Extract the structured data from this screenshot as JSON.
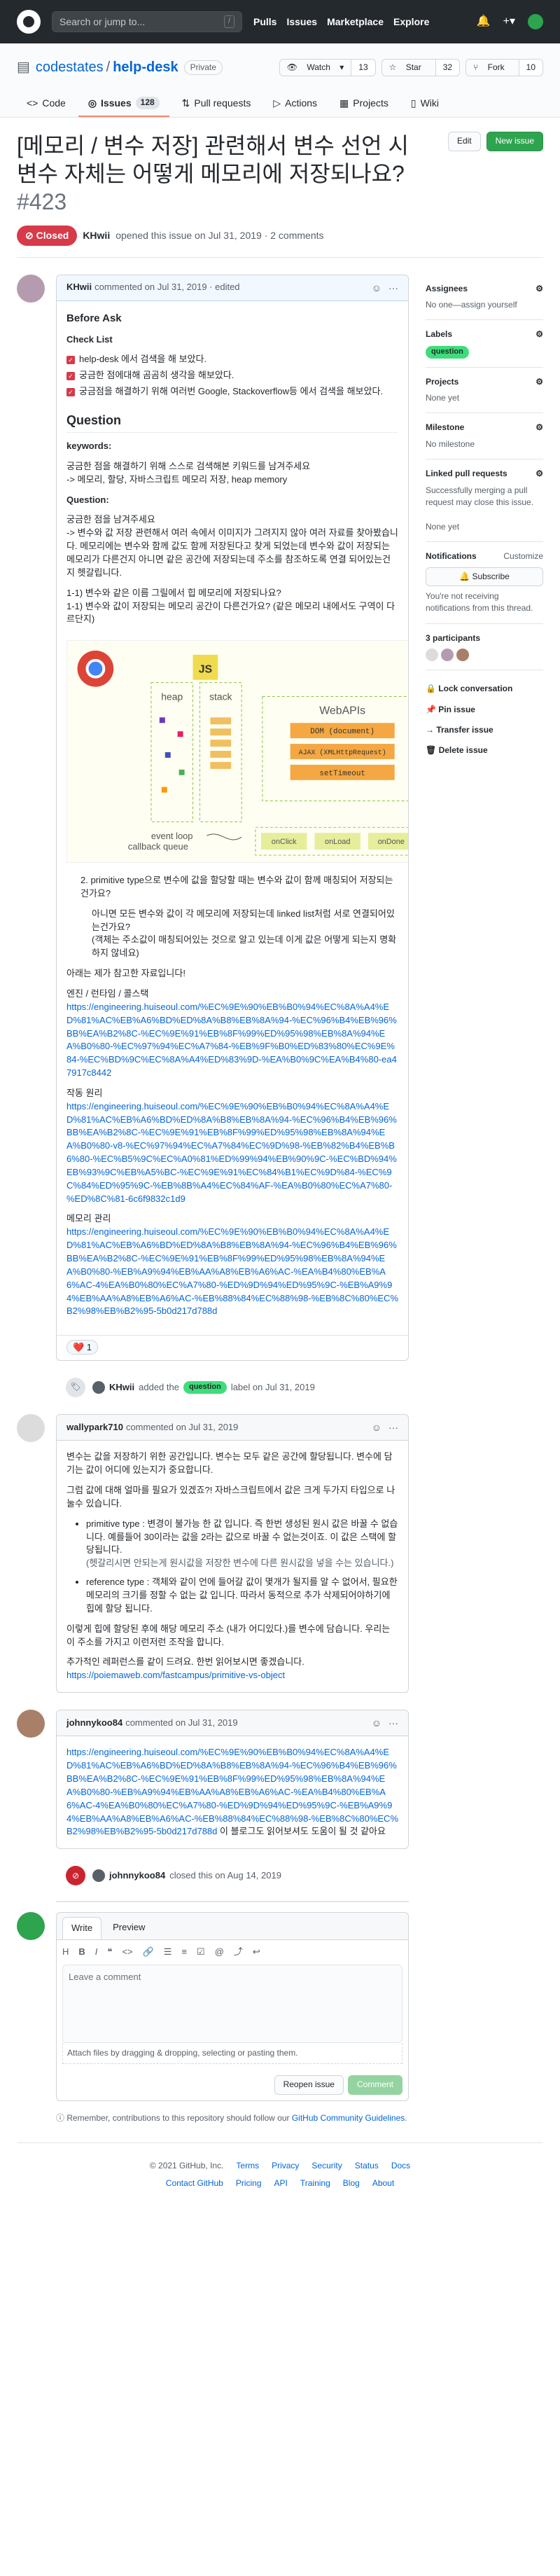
{
  "header": {
    "search_placeholder": "Search or jump to...",
    "search_key": "/",
    "nav": [
      "Pulls",
      "Issues",
      "Marketplace",
      "Explore"
    ]
  },
  "repo": {
    "owner": "codestates",
    "name": "help-desk",
    "visibility": "Private",
    "watch_label": "Watch",
    "watch_count": "13",
    "star_label": "Star",
    "star_count": "32",
    "fork_label": "Fork",
    "fork_count": "10",
    "tabs": [
      {
        "label": "Code"
      },
      {
        "label": "Issues",
        "count": "128"
      },
      {
        "label": "Pull requests"
      },
      {
        "label": "Actions"
      },
      {
        "label": "Projects"
      },
      {
        "label": "Wiki"
      }
    ]
  },
  "issue": {
    "title": "[메모리 / 변수 저장] 관련해서 변수 선언 시 변수 자체는 어떻게 메모리에 저장되나요?",
    "number": "#423",
    "edit_label": "Edit",
    "new_issue_label": "New issue",
    "state": "Closed",
    "author": "KHwii",
    "opened_text": "opened this issue on Jul 31, 2019 · 2 comments"
  },
  "comments": [
    {
      "author": "KHwii",
      "meta": "commented on Jul 31, 2019 · edited",
      "before_ask_title": "Before Ask",
      "checklist_title": "Check List",
      "checklist": [
        "help-desk 에서 검색을 해 보았다.",
        "궁금한 점에대해 곰곰히 생각을 해보았다.",
        "궁금점을 해결하기 위해 여러번 Google, Stackoverflow등 에서 검색을 해보았다."
      ],
      "question_title": "Question",
      "keywords_label": "keywords:",
      "keywords_text": "궁금한 점을 해결하기 위해 스스로 검색해본 키워드를 남겨주세요",
      "keywords_value": "-> 메모리, 할당, 자바스크립트 메모리 저장, heap memory",
      "question_label": "Question:",
      "question_intro": "궁금한 점을 남겨주세요",
      "question_body": "-> 변수와 값 저장 관련해서 여러 속에서 이미지가 그려지지 않아 여러 자료를 찾아봤습니다. 메모리에는 변수와 함께 값도 함께 저장된다고 찾게 되었는데 변수와 값이 저장되는 메모리가 다른건지 아니면 같은 공간에 저장되는데 주소를 참조하도록 연결 되어있는건지 헷갈립니다.",
      "question_items": [
        "1-1) 변수와 같은 이름 그릴에서 힙 메모리에 저장되나요?",
        "1-1) 변수와 값이 저장되는 메모리 공간이 다른건가요? (같은 메모리 내에서도 구역이 다르단지)"
      ],
      "diagram": {
        "heap": "heap",
        "stack": "stack",
        "webapis": "WebAPIs",
        "api1": "DOM (document)",
        "api2": "AJAX (XMLHttpRequest)",
        "api3": "setTimeout",
        "event_loop": "event loop",
        "callback_queue": "callback queue",
        "queue_items": [
          "onClick",
          "onLoad",
          "onDone"
        ],
        "js": "JS"
      },
      "item2_title": "2. primitive type으로 변수에 값을 할당할 때는 변수와 값이 함께 매칭되어 저장되는 건가요?",
      "item2_sub1": "아니면 모든 변수와 값이 각 메모리에 저장되는데 linked list처럼 서로 연결되어있는건가요?",
      "item2_sub2": "(객체는 주소값이 매칭되어있는 것으로 알고 있는데 이게 값은 어떻게 되는지 명확하지 않네요)",
      "refs_intro": "아래는 제가 참고한 자료입니다!",
      "refs": [
        {
          "title": "엔진 / 런타임 / 콜스택",
          "url": "https://engineering.huiseoul.com/%EC%9E%90%EB%B0%94%EC%8A%A4%ED%81%AC%EB%A6%BD%ED%8A%B8%EB%8A%94-%EC%96%B4%EB%96%BB%EA%B2%8C-%EC%9E%91%EB%8F%99%ED%95%98%EB%8A%94%EA%B0%80-%EC%97%94%EC%A7%84-%EB%9F%B0%ED%83%80%EC%9E%84-%EC%BD%9C%EC%8A%A4%ED%83%9D-%EA%B0%9C%EA%B4%80-ea47917c8442"
        },
        {
          "title": "작동 원리",
          "url": "https://engineering.huiseoul.com/%EC%9E%90%EB%B0%94%EC%8A%A4%ED%81%AC%EB%A6%BD%ED%8A%B8%EB%8A%94-%EC%96%B4%EB%96%BB%EA%B2%8C-%EC%9E%91%EB%8F%99%ED%95%98%EB%8A%94%EA%B0%80-v8-%EC%97%94%EC%A7%84%EC%9D%98-%EB%82%B4%EB%B6%80-%EC%B5%9C%EC%A0%81%ED%99%94%EB%90%9C-%EC%BD%94%EB%93%9C%EB%A5%BC-%EC%9E%91%EC%84%B1%EC%9D%84-%EC%9C%84%ED%95%9C-%EB%8B%A4%EC%84%AF-%EA%B0%80%EC%A7%80-%ED%8C%81-6c6f9832c1d9"
        },
        {
          "title": "메모리 관리",
          "url": "https://engineering.huiseoul.com/%EC%9E%90%EB%B0%94%EC%8A%A4%ED%81%AC%EB%A6%BD%ED%8A%B8%EB%8A%94-%EC%96%B4%EB%96%BB%EA%B2%8C-%EC%9E%91%EB%8F%99%ED%95%98%EB%8A%94%EA%B0%80-%EB%A9%94%EB%AA%A8%EB%A6%AC-%EA%B4%80%EB%A6%AC-4%EA%B0%80%EC%A7%80-%ED%9D%94%ED%95%9C-%EB%A9%94%EB%AA%A8%EB%A6%AC-%EB%88%84%EC%88%98-%EB%8C%80%EC%B2%98%EB%B2%95-5b0d217d788d"
        }
      ],
      "reaction": "❤️ 1"
    },
    {
      "author": "wallypark710",
      "meta": "commented on Jul 31, 2019",
      "p1": "변수는 값을 저장하기 위한 공간입니다. 변수는 모두 같은 공간에 할당됩니다. 변수에 담기는 값이 어디에 있는지가 중요합니다.",
      "p2": "그럼 값에 대해 얼마를 필요가 있겠죠?! 자바스크립트에서 값은 크게 두가지 타입으로 나눌수 있습니다.",
      "bullets": [
        {
          "head": "primitive type",
          "text": ": 변경이 불가능 한 값 입니다. 즉 한번 생성된 원시 값은 바꿀 수 없습니다. 예를들어 30이라는 값을 2라는 값으로 바꿀 수 없는것이죠. 이 값은 스택에 할당됩니다.",
          "note": "(헷갈리시면 안되는게 원시값을 저장한 변수에 다른 원시값을 넣을 수는 있습니다.)"
        },
        {
          "head": "reference type",
          "text": ": 객체와 같이 언에 들어갈 값이 몇개가 될지를 알 수 없어서, 필요한 메모리의 크기를 정할 수 없는 값 입니다. 따라서 동적으로 추가 삭제되어야하기에 힙에 할당 됩니다.",
          "note": ""
        }
      ],
      "p3": "이렇게 힙에 할당된 후에 해당 메모리 주소 (내가 어디있다.)를 변수에 담습니다. 우리는 이 주소를 가지고 이런저런 조작을 합니다.",
      "p4": "추가적인 레퍼런스를 같이 드려요. 한번 읽어보시면 좋겠습니다.",
      "link": "https://poiemaweb.com/fastcampus/primitive-vs-object"
    },
    {
      "author": "johnnykoo84",
      "meta": "commented on Jul 31, 2019",
      "link": "https://engineering.huiseoul.com/%EC%9E%90%EB%B0%94%EC%8A%A4%ED%81%AC%EB%A6%BD%ED%8A%B8%EB%8A%94-%EC%96%B4%EB%96%BB%EA%B2%8C-%EC%9E%91%EB%8F%99%ED%95%98%EB%8A%94%EA%B0%80-%EB%A9%94%EB%AA%A8%EB%A6%AC-%EA%B4%80%EB%A6%AC-4%EA%B0%80%EC%A7%80-%ED%9D%94%ED%95%9C-%EB%A9%94%EB%AA%A8%EB%A6%AC-%EB%88%84%EC%88%98-%EB%8C%80%EC%B2%98%EB%B2%95-5b0d217d788d",
      "suffix": " 이 블로그도 읽어보셔도 도움이 될 것 같아요"
    }
  ],
  "events": {
    "label_event_user": "KHwii",
    "label_event_text": "added the",
    "label_event_label": "question",
    "label_event_tail": "label on Jul 31, 2019",
    "closed_user": "johnnykoo84",
    "closed_text": "closed this on Aug 14, 2019"
  },
  "sidebar": {
    "assignees_title": "Assignees",
    "assignees_value": "No one—assign yourself",
    "labels_title": "Labels",
    "label": "question",
    "projects_title": "Projects",
    "projects_value": "None yet",
    "milestone_title": "Milestone",
    "milestone_value": "No milestone",
    "linked_title": "Linked pull requests",
    "linked_value": "Successfully merging a pull request may close this issue.",
    "linked_value2": "None yet",
    "notif_title": "Notifications",
    "notif_customize": "Customize",
    "subscribe_label": "Subscribe",
    "notif_text": "You're not receiving notifications from this thread.",
    "participants_title": "3 participants",
    "lock": "Lock conversation",
    "pin": "Pin issue",
    "transfer": "Transfer issue",
    "delete": "Delete issue"
  },
  "composer": {
    "tab_write": "Write",
    "tab_preview": "Preview",
    "placeholder": "Leave a comment",
    "attach_text": "Attach files by dragging & dropping, selecting or pasting them.",
    "reopen": "Reopen issue",
    "comment": "Comment",
    "note_prefix": "Remember, contributions to this repository should follow our ",
    "note_link": "GitHub Community Guidelines"
  },
  "footer": {
    "copyright": "© 2021 GitHub, Inc.",
    "row1": [
      "Terms",
      "Privacy",
      "Security",
      "Status",
      "Docs"
    ],
    "row2": [
      "Contact GitHub",
      "Pricing",
      "API",
      "Training",
      "Blog",
      "About"
    ]
  }
}
